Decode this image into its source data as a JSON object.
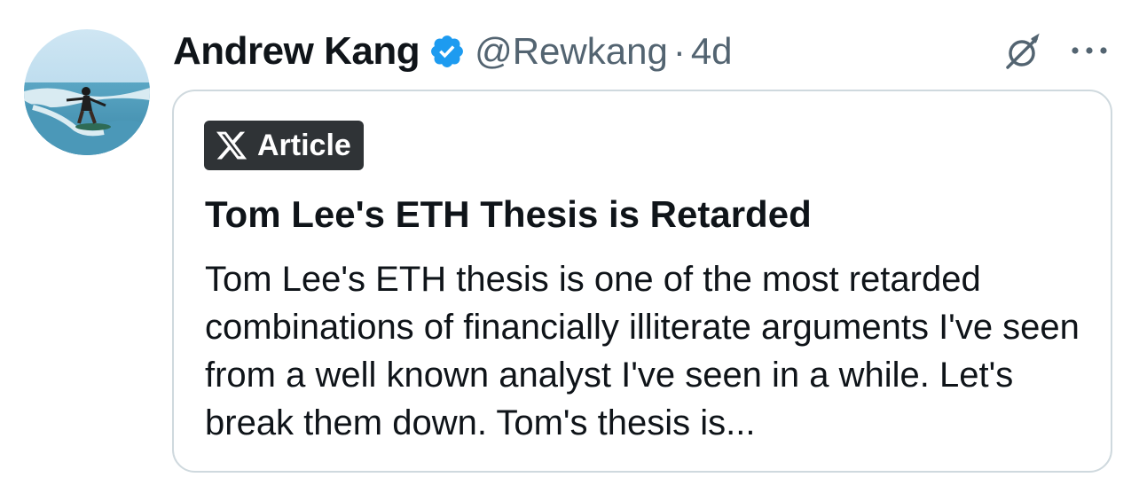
{
  "author": {
    "name": "Andrew Kang",
    "handle": "@Rewkang",
    "separator": "·",
    "timestamp": "4d",
    "verified": true,
    "verified_color": "#1d9bf0"
  },
  "icons": {
    "avatar": "avatar-surfer-photo",
    "verified": "verified-badge-icon",
    "grok": "grok-icon",
    "more": "more-dots-icon",
    "article_badge": "x-logo-icon"
  },
  "article": {
    "badge_label": "Article",
    "title": "Tom Lee's ETH Thesis is Retarded",
    "excerpt": "Tom Lee's ETH thesis is one of the most retarded combinations of financially illiterate arguments I've seen from a well known analyst I've seen in a while. Let's break them down. Tom's thesis is..."
  },
  "colors": {
    "text_primary": "#0f1419",
    "text_secondary": "#536471",
    "card_border": "#cfd9de",
    "badge_bg": "#2f3336"
  }
}
